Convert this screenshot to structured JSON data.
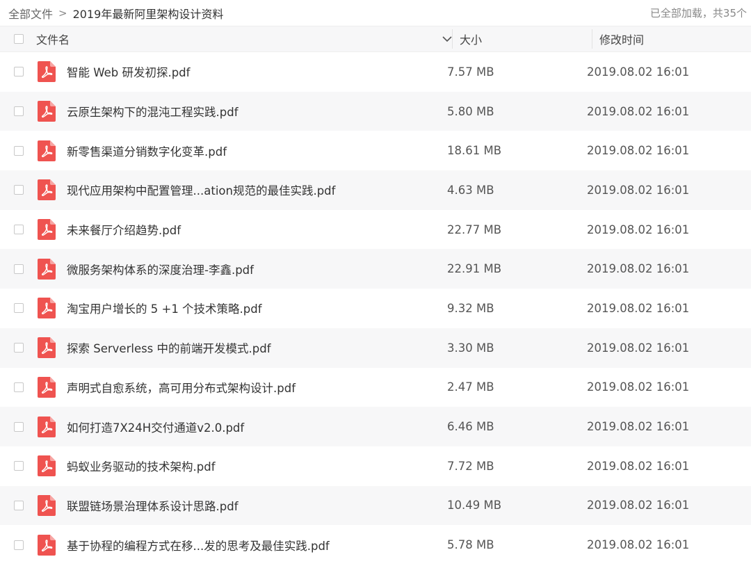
{
  "breadcrumb": {
    "root": "全部文件",
    "separator": ">",
    "current": "2019年最新阿里架构设计资料"
  },
  "status_text": "已全部加载，共35个",
  "columns": {
    "name": "文件名",
    "size": "大小",
    "modified": "修改时间"
  },
  "icons": {
    "file_type": "pdf-file-icon",
    "sort": "chevron-down-icon",
    "separator": "chevron-right-icon"
  },
  "colors": {
    "pdf_icon": "#ef5350",
    "row_alt": "#f7f7f8"
  },
  "files": [
    {
      "name": "智能 Web 研发初探.pdf",
      "size": "7.57 MB",
      "modified": "2019.08.02 16:01"
    },
    {
      "name": "云原生架构下的混沌工程实践.pdf",
      "size": "5.80 MB",
      "modified": "2019.08.02 16:01"
    },
    {
      "name": "新零售渠道分销数字化变革.pdf",
      "size": "18.61 MB",
      "modified": "2019.08.02 16:01"
    },
    {
      "name": "现代应用架构中配置管理...ation规范的最佳实践.pdf",
      "size": "4.63 MB",
      "modified": "2019.08.02 16:01"
    },
    {
      "name": "未来餐厅介绍趋势.pdf",
      "size": "22.77 MB",
      "modified": "2019.08.02 16:01"
    },
    {
      "name": "微服务架构体系的深度治理-李鑫.pdf",
      "size": "22.91 MB",
      "modified": "2019.08.02 16:01"
    },
    {
      "name": "淘宝用户增长的 5 +1 个技术策略.pdf",
      "size": "9.32 MB",
      "modified": "2019.08.02 16:01"
    },
    {
      "name": "探索 Serverless 中的前端开发模式.pdf",
      "size": "3.30 MB",
      "modified": "2019.08.02 16:01"
    },
    {
      "name": "声明式自愈系统，高可用分布式架构设计.pdf",
      "size": "2.47 MB",
      "modified": "2019.08.02 16:01"
    },
    {
      "name": "如何打造7X24H交付通道v2.0.pdf",
      "size": "6.46 MB",
      "modified": "2019.08.02 16:01"
    },
    {
      "name": "蚂蚁业务驱动的技术架构.pdf",
      "size": "7.72 MB",
      "modified": "2019.08.02 16:01"
    },
    {
      "name": "联盟链场景治理体系设计思路.pdf",
      "size": "10.49 MB",
      "modified": "2019.08.02 16:01"
    },
    {
      "name": "基于协程的编程方式在移...发的思考及最佳实践.pdf",
      "size": "5.78 MB",
      "modified": "2019.08.02 16:01"
    }
  ]
}
